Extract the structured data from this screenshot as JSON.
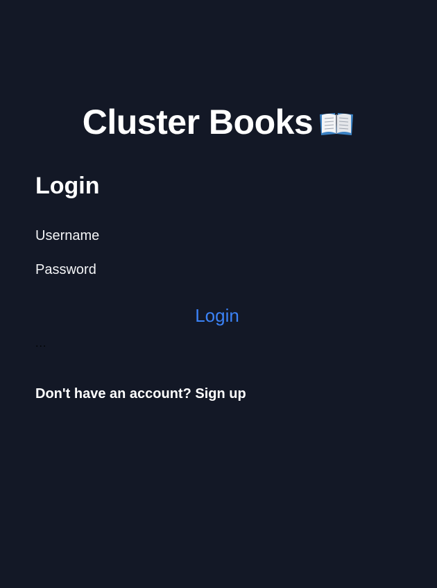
{
  "app": {
    "title": "Cluster Books",
    "title_icon": "open-book-icon"
  },
  "login_form": {
    "heading": "Login",
    "username_label": "Username",
    "password_label": "Password",
    "username_value": "",
    "password_value": "",
    "submit_label": "Login",
    "status_text": "...",
    "signup_prompt": "Don't have an account?",
    "signup_link": "Sign up"
  },
  "colors": {
    "background": "#131826",
    "text": "#ffffff",
    "accent": "#3b82f6"
  }
}
